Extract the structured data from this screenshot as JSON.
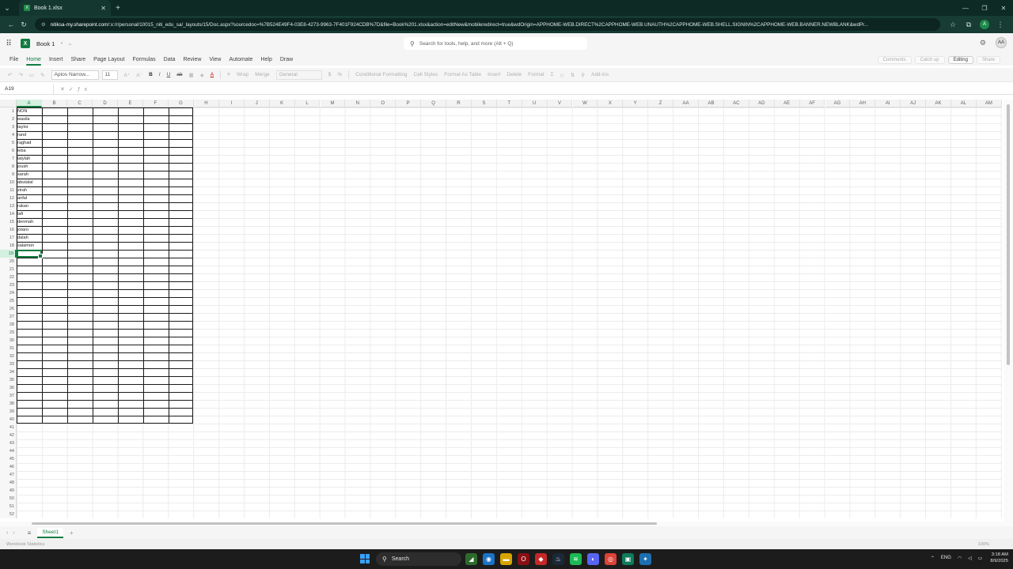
{
  "browser": {
    "tab_title": "Book 1.xlsx",
    "tab_close": "✕",
    "new_tab": "+",
    "url_host": "nitiksa-my.sharepoint.com",
    "url_path": "/:x:/r/personal/10015_niti_edu_sa/_layouts/15/Doc.aspx?sourcedoc=%7B524E49F4-03E8-4273-9963-7F401F924CDB%7D&file=Book%201.xlsx&action=editNew&mobileredirect=true&wdOrigin=APPHOME-WEB.DIRECT%2CAPPHOME-WEB.UNAUTH%2CAPPHOME-WEB.SHELL.SIGNIN%2CAPPHOME-WEB.BANNER.NEWBLANK&wdPr...",
    "profile_initial": "A"
  },
  "excel": {
    "book_title": "Book 1",
    "search_placeholder": "Search for tools, help, and more (Alt + Q)",
    "avatar_initials": "AA"
  },
  "ribbon_tabs": [
    "File",
    "Home",
    "Insert",
    "Share",
    "Page Layout",
    "Formulas",
    "Data",
    "Review",
    "View",
    "Automate",
    "Help",
    "Draw"
  ],
  "ribbon_right": {
    "comments": "Comments",
    "catch_up": "Catch up",
    "editing": "Editing",
    "share": "Share"
  },
  "ribbon_tools": {
    "font_name": "Aptos Narrow...",
    "font_size": "11",
    "wrap": "Wrap",
    "merge": "Merge",
    "number_format": "General",
    "conditional_formatting": "Conditional Formatting",
    "cell_styles": "Cell Styles",
    "format_as_table": "Format As Table",
    "insert": "Insert",
    "delete": "Delete",
    "format": "Format",
    "add_ins": "Add-ins"
  },
  "formula_bar": {
    "name_box": "A19",
    "value": ""
  },
  "grid": {
    "columns": [
      "A",
      "B",
      "C",
      "D",
      "E",
      "F",
      "G",
      "H",
      "I",
      "J",
      "K",
      "L",
      "M",
      "N",
      "O",
      "P",
      "Q",
      "R",
      "S",
      "T",
      "U",
      "V",
      "W",
      "X",
      "Y",
      "Z",
      "AA",
      "AB",
      "AC",
      "AD",
      "AE",
      "AF",
      "AG",
      "AH",
      "AI",
      "AJ",
      "AK",
      "AL",
      "AM"
    ],
    "row_count": 52,
    "selected_column": "A",
    "selected_row": 19,
    "column_a_values": [
      "NON",
      "wasila",
      "taylor",
      "rand",
      "raghad",
      "leba",
      "latylah",
      "joush",
      "sarah",
      "abutalal",
      "zirah",
      "anfal",
      "rakan",
      "lafi",
      "denmah",
      "jotaro",
      "dalah",
      "salamon"
    ]
  },
  "sheet_tabs": [
    "Sheet1"
  ],
  "status_bar": {
    "left": "Workbook Statistics",
    "zoom": "100%"
  },
  "taskbar": {
    "search_label": "Search",
    "lang": "ENG",
    "time": "3:18 AM",
    "date": "8/9/2025"
  }
}
